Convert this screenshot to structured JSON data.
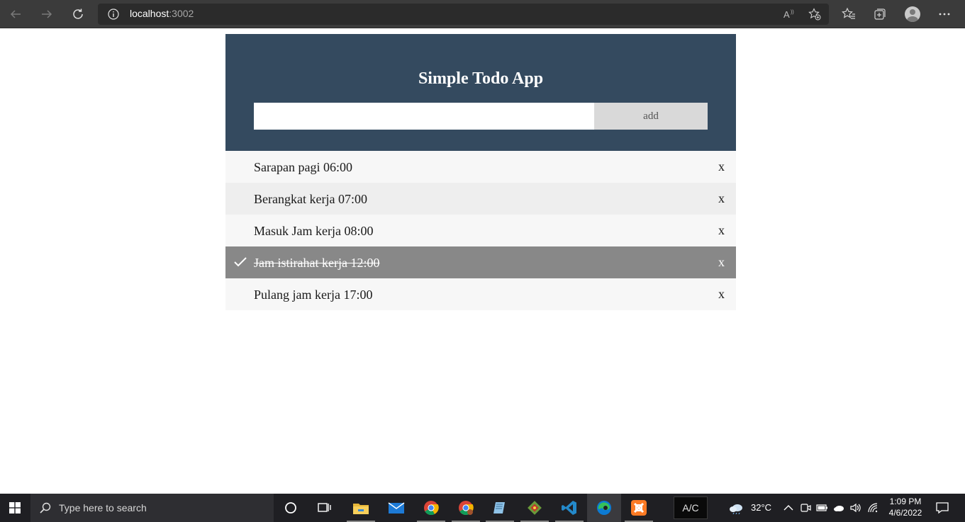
{
  "browser": {
    "url_host": "localhost",
    "url_port": ":3002"
  },
  "app": {
    "title": "Simple Todo App",
    "input_value": "",
    "input_placeholder": "",
    "add_label": "add",
    "items": [
      {
        "text": "Sarapan pagi 06:00",
        "checked": false,
        "close": "x"
      },
      {
        "text": "Berangkat kerja 07:00",
        "checked": false,
        "close": "x"
      },
      {
        "text": "Masuk Jam kerja 08:00",
        "checked": false,
        "close": "x"
      },
      {
        "text": "Jam istirahat kerja 12:00",
        "checked": true,
        "close": "x"
      },
      {
        "text": "Pulang jam kerja 17:00",
        "checked": false,
        "close": "x"
      }
    ],
    "colors": {
      "header": "#344a5f",
      "checked_row": "#888888"
    }
  },
  "taskbar": {
    "search_placeholder": "Type here to search",
    "ac_label": "A/C",
    "temperature": "32°C",
    "time": "1:09 PM",
    "date": "4/6/2022",
    "apps": [
      "cortana-icon",
      "task-view-icon",
      "file-explorer-icon",
      "mail-icon",
      "chrome-icon",
      "chrome-profile-icon",
      "notepad-icon",
      "git-icon",
      "vscode-icon",
      "edge-icon",
      "xampp-icon"
    ]
  }
}
